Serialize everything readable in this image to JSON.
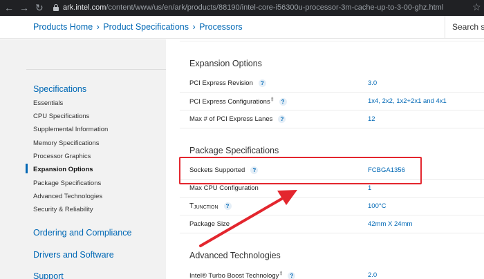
{
  "browser": {
    "url_host": "ark.intel.com",
    "url_path": "/content/www/us/en/ark/products/88190/intel-core-i56300u-processor-3m-cache-up-to-3-00-ghz.html"
  },
  "breadcrumb": {
    "items": [
      "Products Home",
      "Product Specifications",
      "Processors"
    ],
    "separator": "›"
  },
  "search": {
    "label": "Search sp"
  },
  "sidebar": {
    "specifications_title": "Specifications",
    "items": [
      "Essentials",
      "CPU Specifications",
      "Supplemental Information",
      "Memory Specifications",
      "Processor Graphics",
      "Expansion Options",
      "Package Specifications",
      "Advanced Technologies",
      "Security & Reliability"
    ],
    "active_item": "Expansion Options",
    "sections": [
      "Ordering and Compliance",
      "Drivers and Software",
      "Support"
    ]
  },
  "expansion_options": {
    "heading": "Expansion Options",
    "rows": [
      {
        "label": "PCI Express Revision",
        "value": "3.0"
      },
      {
        "label": "PCI Express Configurations",
        "dagger": "‡",
        "value": "1x4, 2x2, 1x2+2x1 and 4x1"
      },
      {
        "label": "Max # of PCI Express Lanes",
        "value": "12"
      }
    ]
  },
  "package_specifications": {
    "heading": "Package Specifications",
    "rows": [
      {
        "label": "Sockets Supported",
        "value": "FCBGA1356"
      },
      {
        "label": "Max CPU Configuration",
        "value": "1"
      },
      {
        "label_main": "T",
        "label_sub": "JUNCTION",
        "value": "100°C"
      },
      {
        "label": "Package Size",
        "value": "42mm X 24mm"
      }
    ]
  },
  "advanced_technologies": {
    "heading": "Advanced Technologies",
    "rows": [
      {
        "label": "Intel® Turbo Boost Technology",
        "dagger": "‡",
        "value": "2.0"
      }
    ]
  },
  "help_icon_glyph": "?",
  "icons": {
    "back": "arrow-left-icon",
    "forward": "arrow-right-icon",
    "reload": "reload-icon",
    "lock": "lock-icon",
    "star": "star-icon",
    "help": "question-icon"
  },
  "colors": {
    "intel_blue": "#0068b5",
    "annotation_red": "#e3262e",
    "sidebar_bg": "#f2f2f2",
    "browser_bar": "#202124"
  }
}
